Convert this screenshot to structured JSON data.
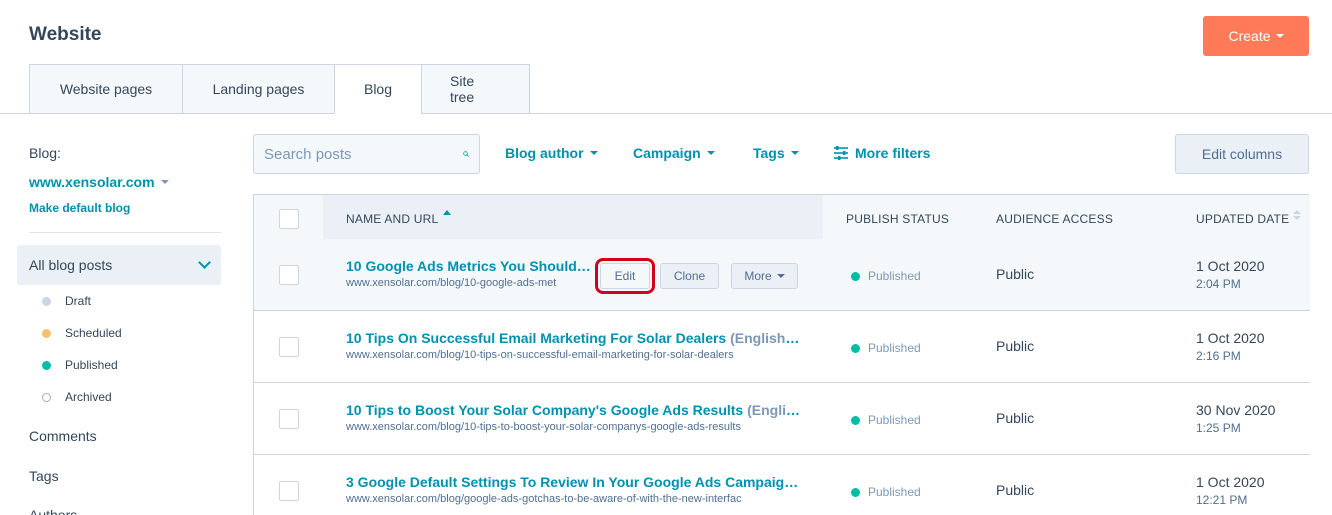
{
  "header": {
    "title": "Website",
    "create_label": "Create"
  },
  "tabs": [
    {
      "label": "Website pages",
      "active": false
    },
    {
      "label": "Landing pages",
      "active": false
    },
    {
      "label": "Blog",
      "active": true
    },
    {
      "label": "Site tree",
      "active": false
    }
  ],
  "sidebar": {
    "blog_label": "Blog:",
    "blog_domain": "www.xensolar.com",
    "make_default": "Make default blog",
    "all_posts": "All blog posts",
    "statuses": [
      {
        "label": "Draft",
        "color": "#cbd6e2"
      },
      {
        "label": "Scheduled",
        "color": "#f5c26b"
      },
      {
        "label": "Published",
        "color": "#00bda5"
      },
      {
        "label": "Archived",
        "color": "#ffffff"
      }
    ],
    "links": [
      "Comments",
      "Tags",
      "Authors"
    ]
  },
  "filters": {
    "search_placeholder": "Search posts",
    "blog_author": "Blog author",
    "campaign": "Campaign",
    "tags": "Tags",
    "more_filters": "More filters",
    "edit_columns": "Edit columns"
  },
  "table": {
    "columns": [
      "NAME AND URL",
      "PUBLISH STATUS",
      "AUDIENCE ACCESS",
      "UPDATED DATE"
    ],
    "row_actions": {
      "edit": "Edit",
      "clone": "Clone",
      "more": "More"
    },
    "rows": [
      {
        "title": "10 Google Ads Metrics You Should ...",
        "lang": "",
        "url": "www.xensolar.com/blog/10-google-ads-met",
        "status": "Published",
        "access": "Public",
        "date": "1 Oct 2020",
        "time": "2:04 PM"
      },
      {
        "title": "10 Tips On Successful Email Marketing For Solar Dealers",
        "lang": "(English - ...",
        "url": "www.xensolar.com/blog/10-tips-on-successful-email-marketing-for-solar-dealers",
        "status": "Published",
        "access": "Public",
        "date": "1 Oct 2020",
        "time": "2:16 PM"
      },
      {
        "title": "10 Tips to Boost Your Solar Company's Google Ads Results",
        "lang": "(English ...",
        "url": "www.xensolar.com/blog/10-tips-to-boost-your-solar-companys-google-ads-results",
        "status": "Published",
        "access": "Public",
        "date": "30 Nov 2020",
        "time": "1:25 PM"
      },
      {
        "title": "3 Google Default Settings To Review In Your Google Ads Campaign...",
        "lang": "",
        "url": "www.xensolar.com/blog/google-ads-gotchas-to-be-aware-of-with-the-new-interfac",
        "status": "Published",
        "access": "Public",
        "date": "1 Oct 2020",
        "time": "12:21 PM"
      }
    ]
  }
}
